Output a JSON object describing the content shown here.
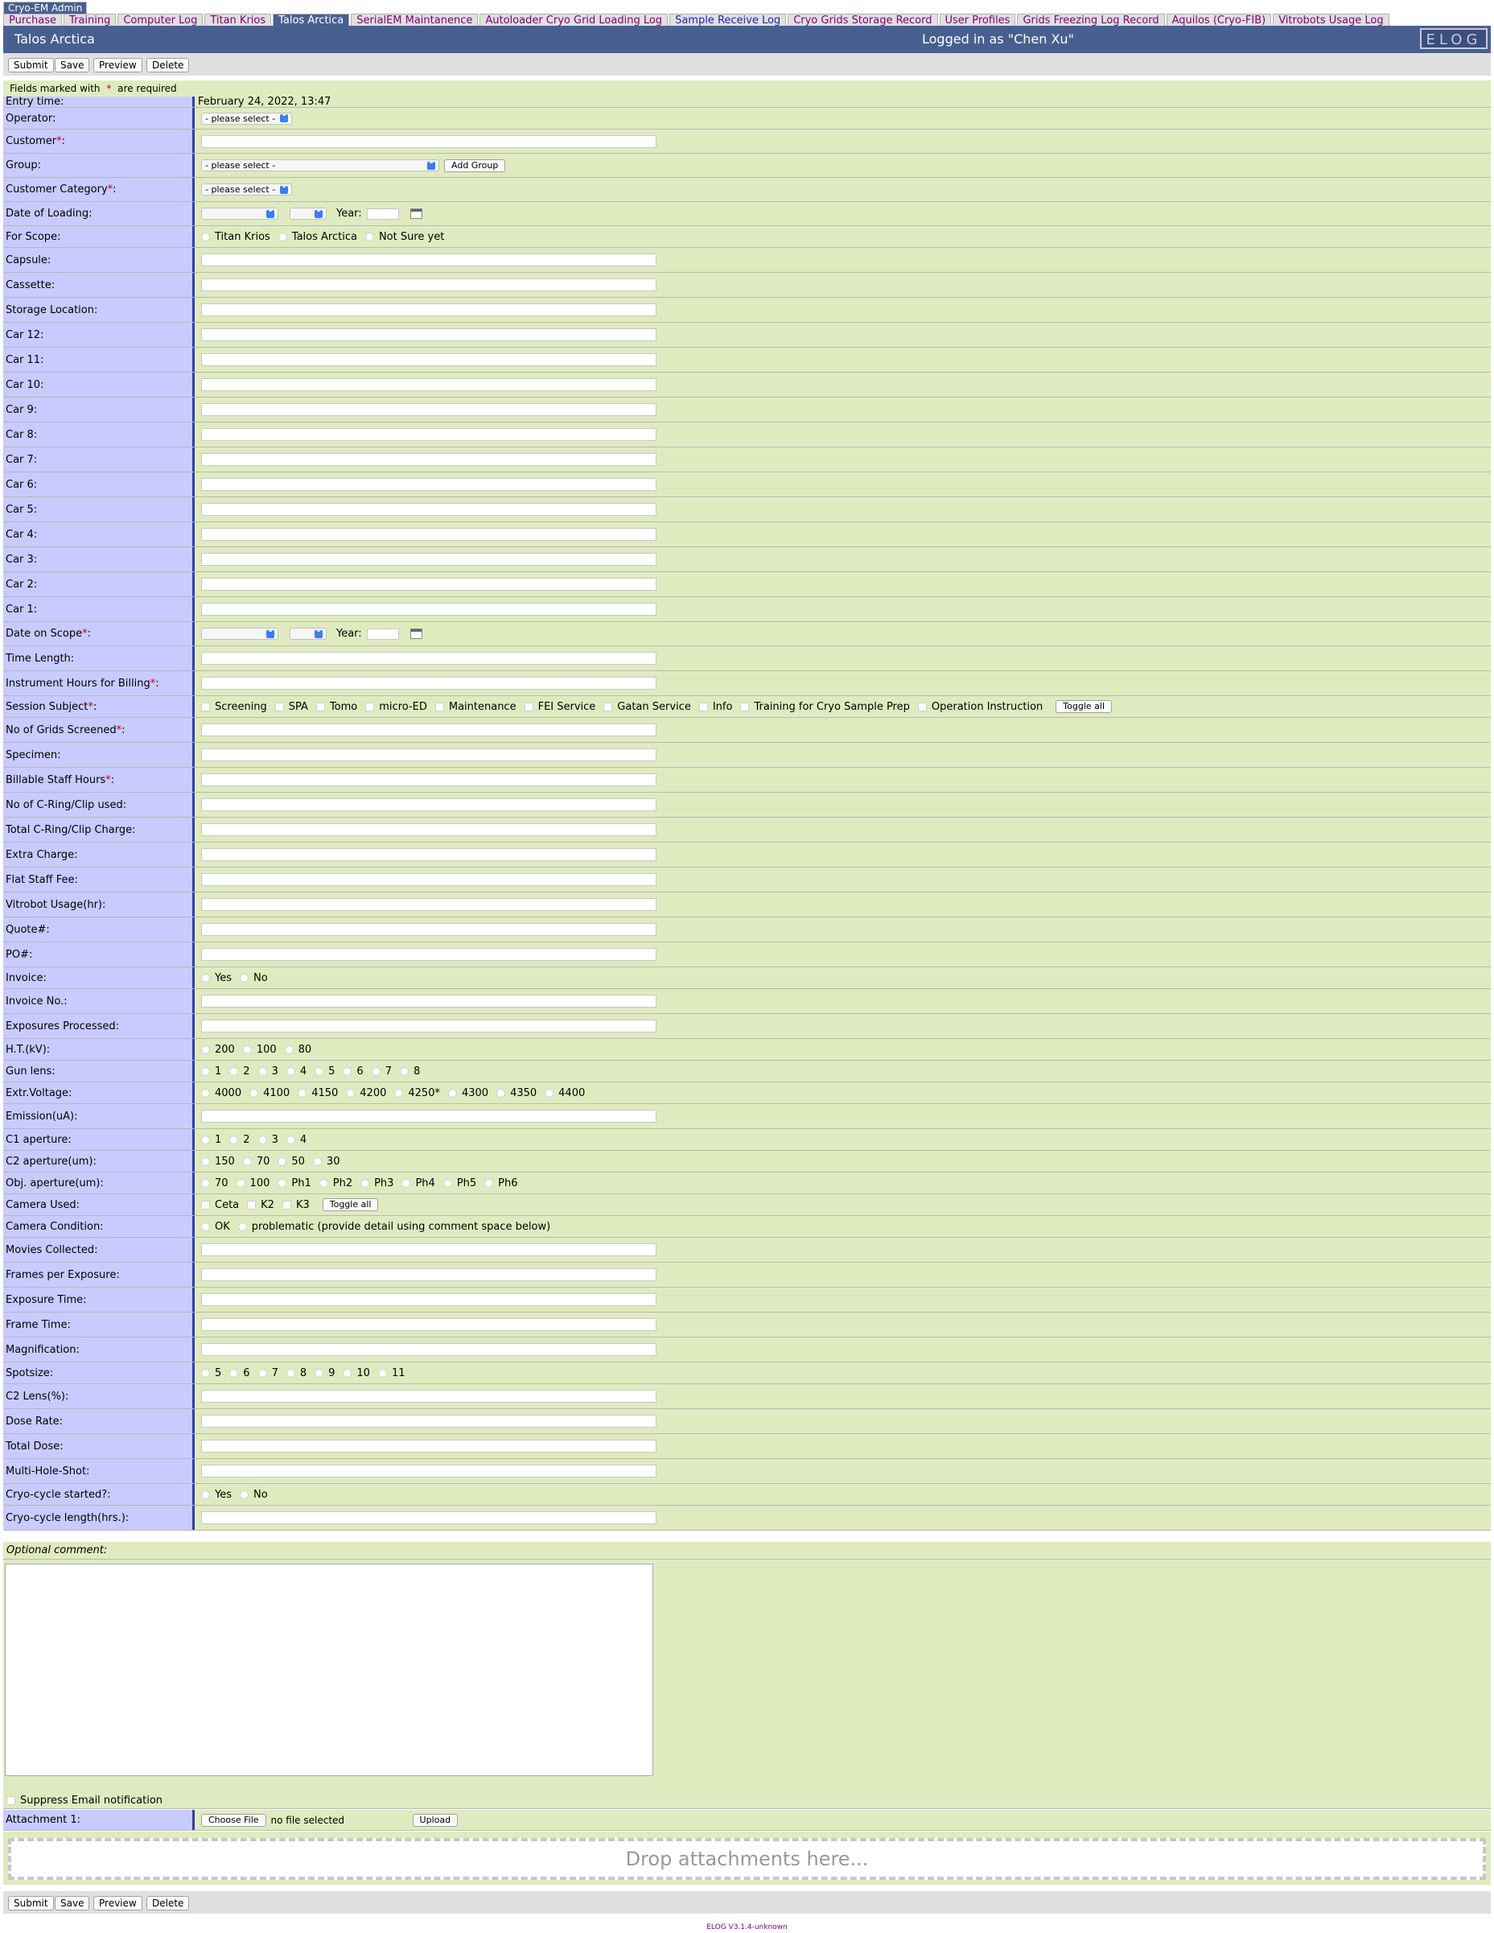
{
  "group_tab": "Cryo-EM Admin",
  "tabs": [
    {
      "label": "Purchase",
      "active": false
    },
    {
      "label": "Training",
      "active": false
    },
    {
      "label": "Computer Log",
      "active": false
    },
    {
      "label": "Titan Krios",
      "active": false
    },
    {
      "label": "Talos Arctica",
      "active": true
    },
    {
      "label": "SerialEM Maintanence",
      "active": false
    },
    {
      "label": "Autoloader Cryo Grid Loading Log",
      "active": false
    },
    {
      "label": "Sample Receive Log",
      "active": false
    },
    {
      "label": "Cryo Grids Storage Record",
      "active": false
    },
    {
      "label": "User Profiles",
      "active": false
    },
    {
      "label": "Grids Freezing Log Record",
      "active": false
    },
    {
      "label": "Aquilos (Cryo-FIB)",
      "active": false
    },
    {
      "label": "Vitrobots Usage Log",
      "active": false
    }
  ],
  "title": {
    "logbook": "Talos Arctica",
    "logged_in": "Logged in as \"Chen Xu\"",
    "logo": "ELOG"
  },
  "buttons": {
    "submit": "Submit",
    "save": "Save",
    "preview": "Preview",
    "delete": "Delete"
  },
  "required_note": {
    "before": "Fields marked with ",
    "star": "*",
    "after": " are required"
  },
  "colors": {
    "header": "#486090",
    "label_bg": "#c8cbff",
    "value_bg": "#dfebbf",
    "required": "#cc0000"
  },
  "fields": [
    {
      "label": "Entry time:",
      "type": "static",
      "value": "February 24, 2022, 13:47"
    },
    {
      "label": "Operator:",
      "type": "select",
      "value": "- please select -"
    },
    {
      "label": "Customer",
      "required": true,
      "type": "text"
    },
    {
      "label": "Group:",
      "type": "select-wide",
      "value": "- please select -",
      "button": "Add Group"
    },
    {
      "label": "Customer Category",
      "required": true,
      "type": "select",
      "value": "- please select -"
    },
    {
      "label": "Date of Loading:",
      "type": "date",
      "year_label": "Year:"
    },
    {
      "label": "For Scope:",
      "type": "radio",
      "options": [
        "Titan Krios",
        "Talos Arctica",
        "Not Sure yet"
      ]
    },
    {
      "label": "Capsule:",
      "type": "text"
    },
    {
      "label": "Cassette:",
      "type": "text"
    },
    {
      "label": "Storage Location:",
      "type": "text"
    },
    {
      "label": "Car 12:",
      "type": "text"
    },
    {
      "label": "Car 11:",
      "type": "text"
    },
    {
      "label": "Car 10:",
      "type": "text"
    },
    {
      "label": "Car 9:",
      "type": "text"
    },
    {
      "label": "Car 8:",
      "type": "text"
    },
    {
      "label": "Car 7:",
      "type": "text"
    },
    {
      "label": "Car 6:",
      "type": "text"
    },
    {
      "label": "Car 5:",
      "type": "text"
    },
    {
      "label": "Car 4:",
      "type": "text"
    },
    {
      "label": "Car 3:",
      "type": "text"
    },
    {
      "label": "Car 2:",
      "type": "text"
    },
    {
      "label": "Car 1:",
      "type": "text"
    },
    {
      "label": "Date on Scope",
      "required": true,
      "type": "date",
      "year_label": "Year:"
    },
    {
      "label": "Time Length:",
      "type": "text"
    },
    {
      "label": "Instrument Hours for Billing",
      "required": true,
      "type": "text"
    },
    {
      "label": "Session Subject",
      "required": true,
      "type": "check",
      "options": [
        "Screening",
        "SPA",
        "Tomo",
        "micro-ED",
        "Maintenance",
        "FEI Service",
        "Gatan Service",
        "Info",
        "Training for Cryo Sample Prep",
        "Operation Instruction"
      ],
      "button": "Toggle all"
    },
    {
      "label": "No of Grids Screened",
      "required": true,
      "type": "text"
    },
    {
      "label": "Specimen:",
      "type": "text"
    },
    {
      "label": "Billable Staff Hours",
      "required": true,
      "type": "text"
    },
    {
      "label": "No of C-Ring/Clip used:",
      "type": "text"
    },
    {
      "label": "Total C-Ring/Clip Charge:",
      "type": "text"
    },
    {
      "label": "Extra Charge:",
      "type": "text"
    },
    {
      "label": "Flat Staff Fee:",
      "type": "text"
    },
    {
      "label": "Vitrobot Usage(hr):",
      "type": "text"
    },
    {
      "label": "Quote#:",
      "type": "text"
    },
    {
      "label": "PO#:",
      "type": "text"
    },
    {
      "label": "Invoice:",
      "type": "radio",
      "options": [
        "Yes",
        "No"
      ]
    },
    {
      "label": "Invoice No.:",
      "type": "text"
    },
    {
      "label": "Exposures Processed:",
      "type": "text"
    },
    {
      "label": "H.T.(kV):",
      "type": "radio",
      "options": [
        "200",
        "100",
        "80"
      ]
    },
    {
      "label": "Gun lens:",
      "type": "radio",
      "options": [
        "1",
        "2",
        "3",
        "4",
        "5",
        "6",
        "7",
        "8"
      ]
    },
    {
      "label": "Extr.Voltage:",
      "type": "radio",
      "options": [
        "4000",
        "4100",
        "4150",
        "4200",
        "4250*",
        "4300",
        "4350",
        "4400"
      ]
    },
    {
      "label": "Emission(uA):",
      "type": "text"
    },
    {
      "label": "C1 aperture:",
      "type": "radio",
      "options": [
        "1",
        "2",
        "3",
        "4"
      ]
    },
    {
      "label": "C2 aperture(um):",
      "type": "radio",
      "options": [
        "150",
        "70",
        "50",
        "30"
      ]
    },
    {
      "label": "Obj. aperture(um):",
      "type": "radio",
      "options": [
        "70",
        "100",
        "Ph1",
        "Ph2",
        "Ph3",
        "Ph4",
        "Ph5",
        "Ph6"
      ]
    },
    {
      "label": "Camera Used:",
      "type": "check",
      "options": [
        "Ceta",
        "K2",
        "K3"
      ],
      "button": "Toggle all"
    },
    {
      "label": "Camera Condition:",
      "type": "radio",
      "options": [
        "OK",
        "problematic (provide detail using comment space below)"
      ]
    },
    {
      "label": "Movies Collected:",
      "type": "text"
    },
    {
      "label": "Frames per Exposure:",
      "type": "text"
    },
    {
      "label": "Exposure Time:",
      "type": "text"
    },
    {
      "label": "Frame Time:",
      "type": "text"
    },
    {
      "label": "Magnification:",
      "type": "text"
    },
    {
      "label": "Spotsize:",
      "type": "radio",
      "options": [
        "5",
        "6",
        "7",
        "8",
        "9",
        "10",
        "11"
      ]
    },
    {
      "label": "C2 Lens(%):",
      "type": "text"
    },
    {
      "label": "Dose Rate:",
      "type": "text"
    },
    {
      "label": "Total Dose:",
      "type": "text"
    },
    {
      "label": "Multi-Hole-Shot:",
      "type": "text"
    },
    {
      "label": "Cryo-cycle started?:",
      "type": "radio",
      "options": [
        "Yes",
        "No"
      ]
    },
    {
      "label": "Cryo-cycle length(hrs.):",
      "type": "text"
    }
  ],
  "comment_label": "Optional comment:",
  "suppress_label": "Suppress Email notification",
  "attachment": {
    "label": "Attachment 1:",
    "choose": "Choose File",
    "status": "no file selected",
    "upload": "Upload"
  },
  "drop_text": "Drop attachments here...",
  "footer": "ELOG V3.1.4-unknown"
}
